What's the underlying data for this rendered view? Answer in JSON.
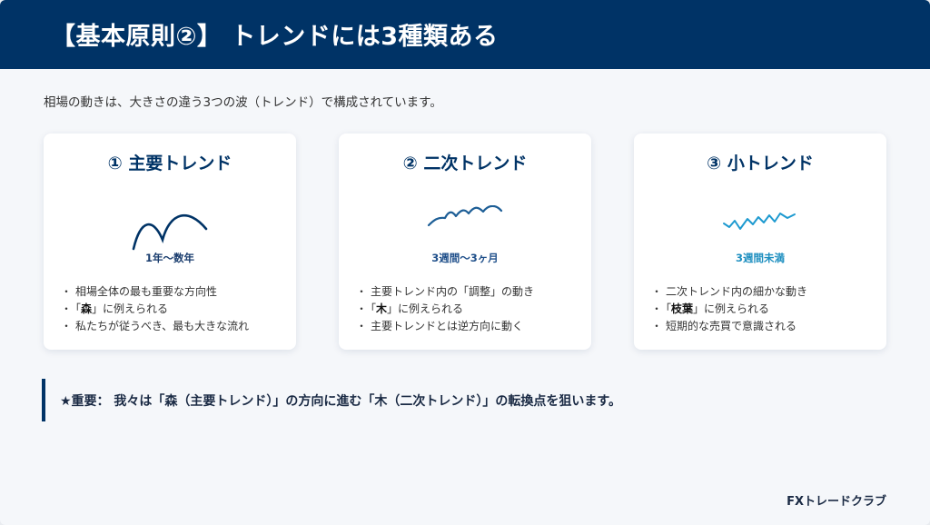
{
  "header": {
    "title": "【基本原則②】 トレンドには3種類ある"
  },
  "intro": "相場の動きは、大きさの違う3つの波（トレンド）で構成されています。",
  "cards": [
    {
      "title": "① 主要トレンド",
      "period": "1年〜数年",
      "period_color": "#1a3d6e",
      "wave_color": "#003366",
      "wave_icon": "large-wave-icon",
      "bullets": [
        {
          "pre": "「",
          "bold": "森",
          "post": "」に例えられる",
          "plain": ""
        },
        {
          "pre": "",
          "bold": "",
          "post": "",
          "plain": "相場全体の最も重要な方向性"
        },
        {
          "pre": "",
          "bold": "",
          "post": "",
          "plain": "私たちが従うべき、最も大きな流れ"
        }
      ]
    },
    {
      "title": "② 二次トレンド",
      "period": "3週間〜3ヶ月",
      "period_color": "#1f4f8a",
      "wave_color": "#1d5e96",
      "wave_icon": "medium-wave-icon",
      "bullets": [
        {
          "pre": "",
          "bold": "",
          "post": "",
          "plain": "主要トレンド内の「調整」の動き"
        },
        {
          "pre": "「",
          "bold": "木",
          "post": "」に例えられる",
          "plain": ""
        },
        {
          "pre": "",
          "bold": "",
          "post": "",
          "plain": "主要トレンドとは逆方向に動く"
        }
      ]
    },
    {
      "title": "③ 小トレンド",
      "period": "3週間未満",
      "period_color": "#1e8fc0",
      "wave_color": "#1e9ad0",
      "wave_icon": "small-wave-icon",
      "bullets": [
        {
          "pre": "",
          "bold": "",
          "post": "",
          "plain": "二次トレンド内の細かな動き"
        },
        {
          "pre": "「",
          "bold": "枝葉",
          "post": "」に例えられる",
          "plain": ""
        },
        {
          "pre": "",
          "bold": "",
          "post": "",
          "plain": "短期的な売買で意識される"
        }
      ]
    }
  ],
  "callout": "★重要： 我々は「森（主要トレンド）」の方向に進む「木（二次トレンド）」の転換点を狙います。",
  "footer": "FXトレードクラブ"
}
